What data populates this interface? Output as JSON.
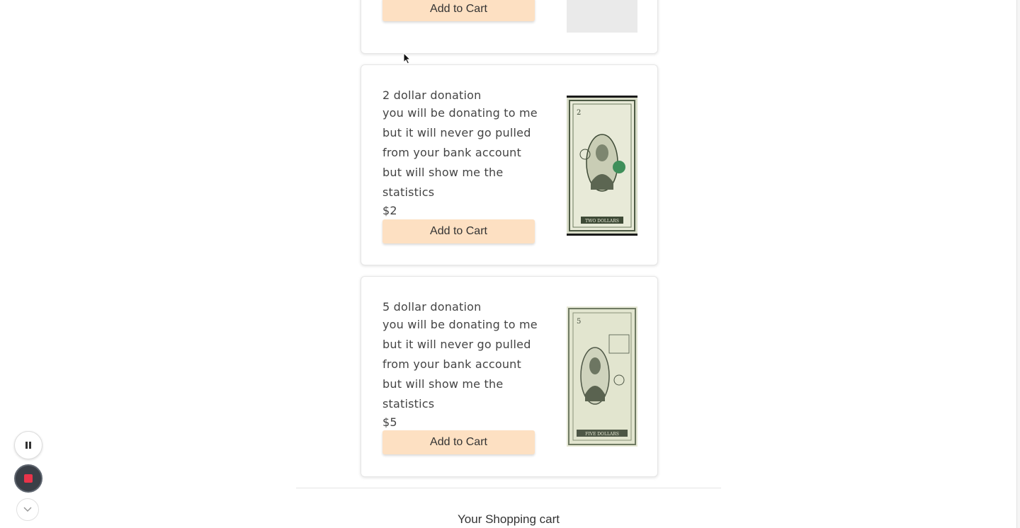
{
  "products": [
    {
      "add_to_cart_label": "Add to Cart"
    },
    {
      "title": "2 dollar donation",
      "description_lines": [
        "you will be donating to me",
        "but it will never go pulled",
        "from your bank account",
        "but will show me the",
        "statistics"
      ],
      "price": "$2",
      "add_to_cart_label": "Add to Cart",
      "image_icon": "two-dollar-bill",
      "bill_corner": "2",
      "bill_caption": "TWO DOLLARS"
    },
    {
      "title": "5 dollar donation",
      "description_lines": [
        "you will be donating to me",
        "but it will never go pulled",
        "from your bank account",
        "but will show me the",
        "statistics"
      ],
      "price": "$5",
      "add_to_cart_label": "Add to Cart",
      "image_icon": "five-dollar-bill",
      "bill_corner": "5",
      "bill_caption": "FIVE DOLLARS"
    }
  ],
  "cart": {
    "heading": "Your Shopping cart"
  },
  "recorder": {
    "pause_icon": "pause-icon",
    "stop_icon": "stop-icon",
    "collapse_icon": "chevron-down-icon"
  },
  "colors": {
    "button_bg": "#fde0c2",
    "stop_red": "#e8344a",
    "text": "#444444"
  }
}
